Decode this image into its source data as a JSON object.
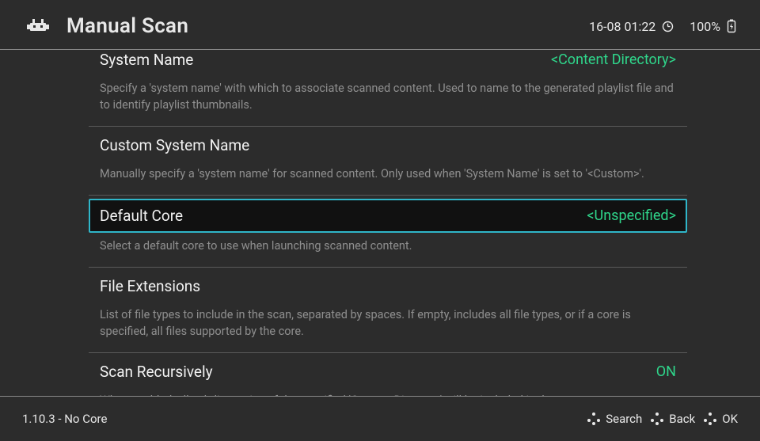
{
  "header": {
    "title": "Manual Scan",
    "datetime": "16-08 01:22",
    "battery_pct": "100%"
  },
  "items": [
    {
      "label": "System Name",
      "value": "<Content Directory>",
      "desc": "Specify a 'system name' with which to associate scanned content. Used to name to the generated playlist file and to identify playlist thumbnails."
    },
    {
      "label": "Custom System Name",
      "value": "",
      "desc": "Manually specify a 'system name' for scanned content. Only used when 'System Name' is set to '<Custom>'."
    },
    {
      "label": "Default Core",
      "value": "<Unspecified>",
      "desc": "Select a default core to use when launching scanned content."
    },
    {
      "label": "File Extensions",
      "value": "",
      "desc": "List of file types to include in the scan, separated by spaces. If empty, includes all file types, or if a core is specified, all files supported by the core."
    },
    {
      "label": "Scan Recursively",
      "value": "ON",
      "desc": "When enabled, all subdirectories of the specified 'Content Directory' will be included in the scan."
    }
  ],
  "footer": {
    "status": "1.10.3 - No Core",
    "hints": {
      "search": "Search",
      "back": "Back",
      "ok": "OK"
    }
  }
}
